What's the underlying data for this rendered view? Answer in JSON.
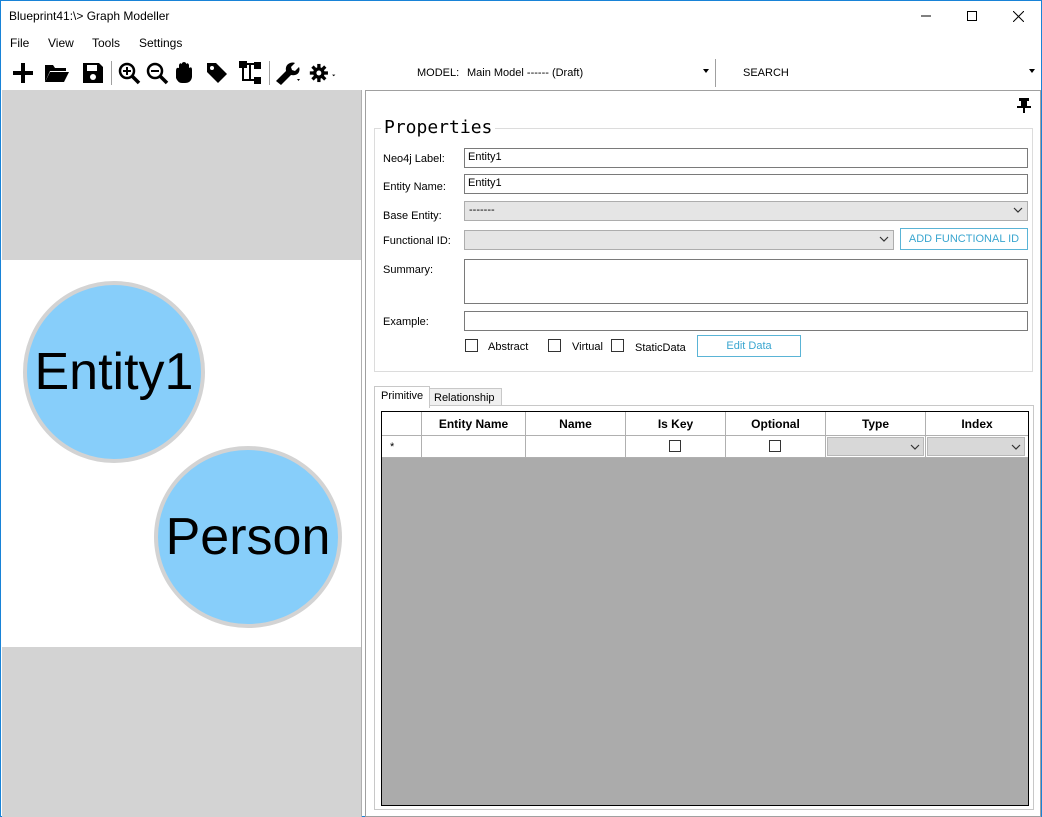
{
  "window": {
    "title": "Blueprint41:\\> Graph Modeller"
  },
  "menu": {
    "items": [
      "File",
      "View",
      "Tools",
      "Settings"
    ]
  },
  "toolbar": {
    "icons": [
      "add-icon",
      "open-folder-icon",
      "save-icon",
      "zoom-in-icon",
      "zoom-out-icon",
      "hand-icon",
      "tag-icon",
      "hierarchy-icon",
      "wrench-icon",
      "gear-icon"
    ],
    "model_label": "MODEL:",
    "model_value": "Main Model ------ (Draft)",
    "search_label": "SEARCH"
  },
  "canvas": {
    "nodes": [
      {
        "label": "Entity1",
        "color": "#87cefa"
      },
      {
        "label": "Person",
        "color": "#87cefa"
      }
    ]
  },
  "properties": {
    "title": "Properties",
    "neo4j_label": {
      "label": "Neo4j Label:",
      "value": "Entity1"
    },
    "entity_name": {
      "label": "Entity Name:",
      "value": "Entity1"
    },
    "base_entity": {
      "label": "Base Entity:",
      "value": "-------"
    },
    "functional_id": {
      "label": "Functional ID:",
      "value": "",
      "button": "ADD FUNCTIONAL ID"
    },
    "summary": {
      "label": "Summary:",
      "value": ""
    },
    "example": {
      "label": "Example:",
      "value": ""
    },
    "checkboxes": [
      {
        "label": "Abstract",
        "checked": false
      },
      {
        "label": "Virtual",
        "checked": false
      },
      {
        "label": "StaticData",
        "checked": false
      }
    ],
    "edit_data_button": "Edit Data"
  },
  "tabs": [
    {
      "label": "Primitive",
      "active": true
    },
    {
      "label": "Relationship",
      "active": false
    }
  ],
  "grid": {
    "columns": [
      "Entity Name",
      "Name",
      "Is Key",
      "Optional",
      "Type",
      "Index"
    ],
    "new_row_marker": "*"
  },
  "colors": {
    "accent": "#3aa6d0",
    "node_fill": "#87cefa",
    "grid_background": "#ababab"
  }
}
